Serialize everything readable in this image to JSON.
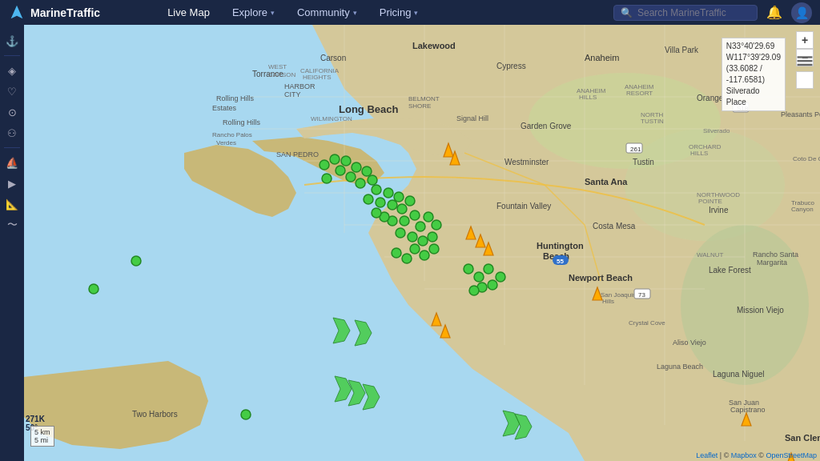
{
  "app": {
    "name": "MarineTraffic"
  },
  "navbar": {
    "live_map_label": "Live Map",
    "explore_label": "Explore",
    "community_label": "Community",
    "pricing_label": "Pricing",
    "search_placeholder": "Search MarineTraffic"
  },
  "sidebar": {
    "items": [
      {
        "name": "anchor-icon",
        "symbol": "⚓"
      },
      {
        "name": "filter-icon",
        "symbol": "◈"
      },
      {
        "name": "heart-icon",
        "symbol": "♡"
      },
      {
        "name": "layers-icon",
        "symbol": "⊙"
      },
      {
        "name": "people-icon",
        "symbol": "⚇"
      },
      {
        "name": "walk-icon",
        "symbol": "⛵"
      },
      {
        "name": "play-icon",
        "symbol": "▶"
      },
      {
        "name": "ruler-icon",
        "symbol": "📐"
      },
      {
        "name": "chart-icon",
        "symbol": "〜"
      }
    ]
  },
  "map": {
    "coords": {
      "lat": "N33°40'29.69",
      "lon": "W117°39'29.09",
      "dec": "(33.6082 / -117.6581)",
      "place": "Silverado Place"
    },
    "zoom": "271K",
    "rotation": "50°",
    "scale_km": "5 km",
    "scale_mi": "5 mi"
  },
  "attribution": {
    "leaflet": "Leaflet",
    "mapbox": "Mapbox",
    "osm": "OpenStreetMap"
  },
  "map_controls": {
    "zoom_in": "+",
    "zoom_out": "−"
  }
}
